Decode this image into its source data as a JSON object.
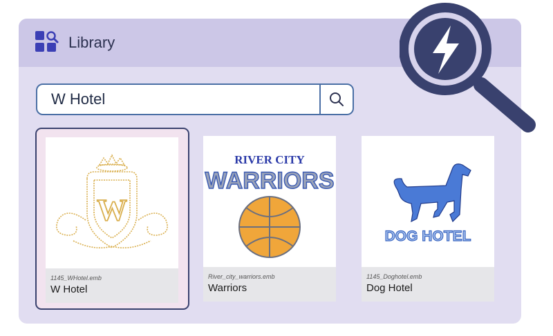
{
  "header": {
    "title": "Library",
    "icon": "library-grid-search-icon"
  },
  "search": {
    "value": "W Hotel",
    "button_icon": "search-icon"
  },
  "results": [
    {
      "filename": "1145_WHotel.emb",
      "name": "W Hotel",
      "thumbnail": "w-hotel-crest-embroidery",
      "selected": true
    },
    {
      "filename": "River_city_warriors.emb",
      "name": "Warriors",
      "thumbnail": "river-city-warriors-basketball-embroidery",
      "selected": false,
      "logo_text": [
        "RIVER CITY",
        "WARRIORS"
      ]
    },
    {
      "filename": "1145_Doghotel.emb",
      "name": "Dog Hotel",
      "thumbnail": "dog-hotel-embroidery",
      "selected": false,
      "logo_text": "DOG HOTEL"
    }
  ],
  "overlay": {
    "icon": "magnifier-lightning-icon"
  },
  "colors": {
    "panel": "#e1ddf1",
    "header": "#ccc7e7",
    "accent": "#39416e",
    "selected_bg": "#f2e3ef",
    "search_border": "#4a6fa5"
  }
}
